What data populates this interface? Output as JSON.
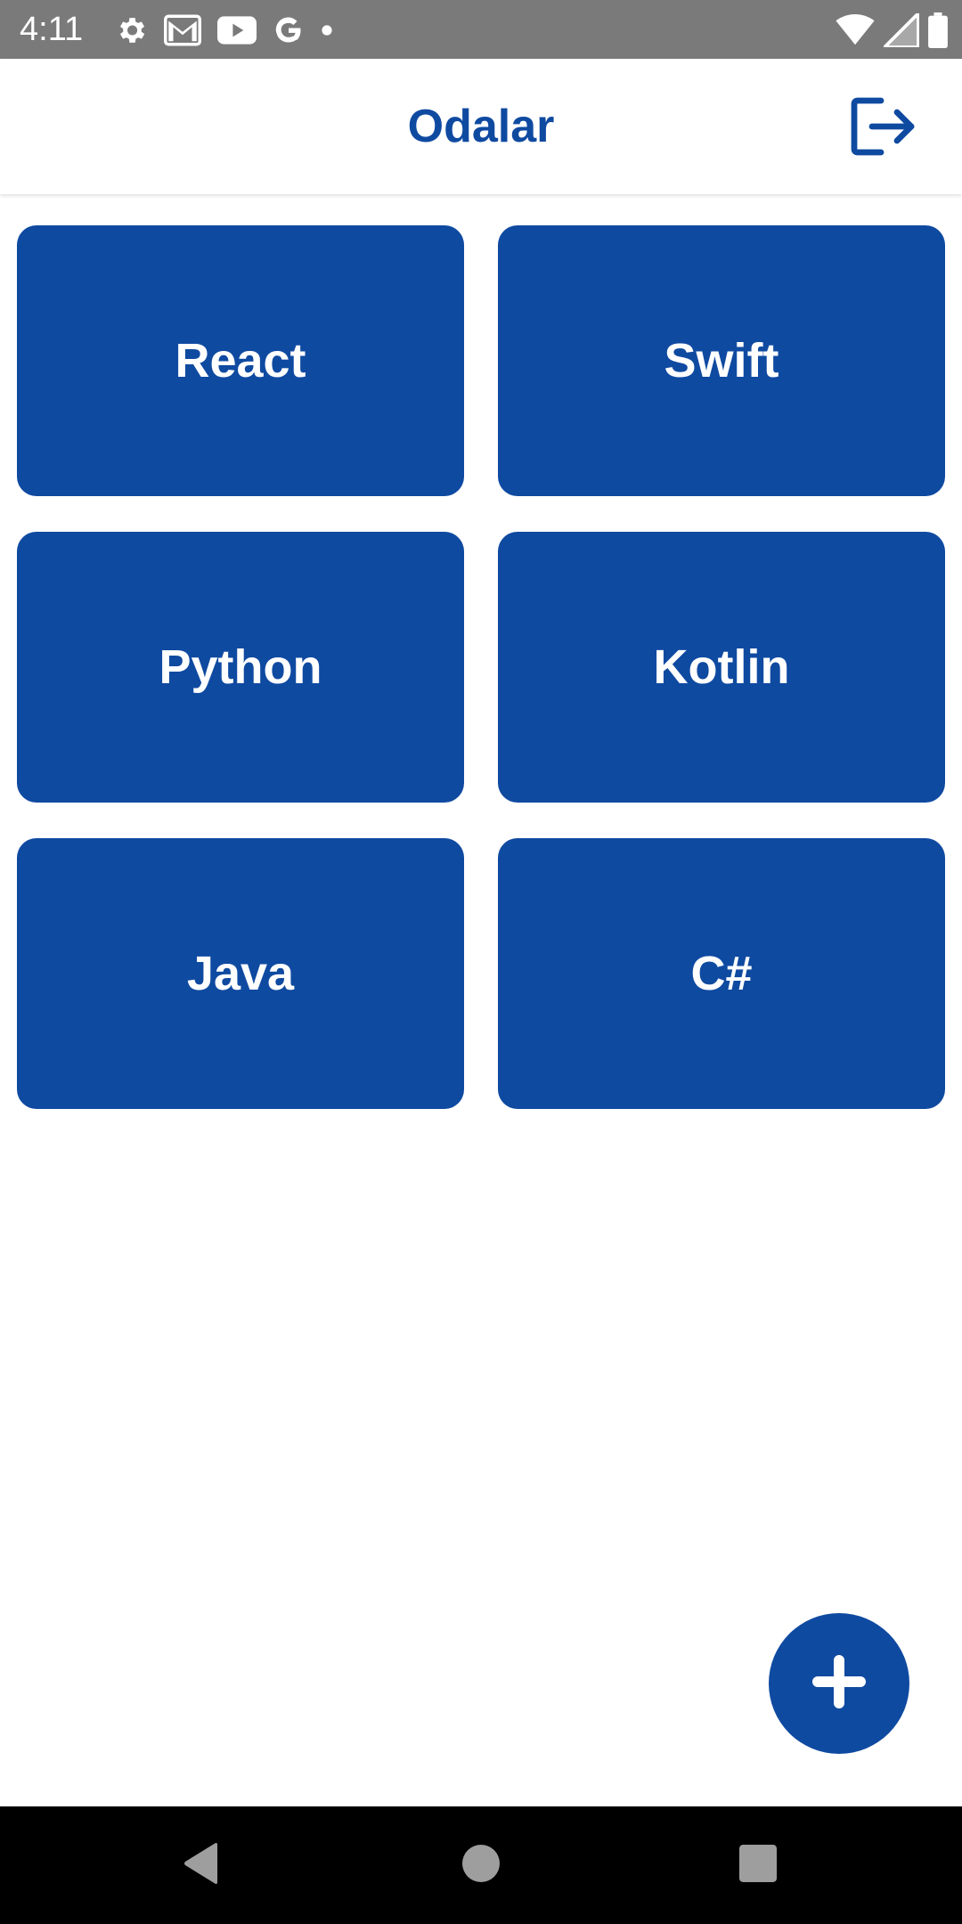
{
  "status_bar": {
    "time": "4:11",
    "left_icons": [
      "gear-icon",
      "gmail-icon",
      "youtube-icon",
      "google-icon",
      "dot-icon"
    ],
    "right_icons": [
      "wifi-icon",
      "signal-icon",
      "battery-icon"
    ]
  },
  "app_bar": {
    "title": "Odalar",
    "action_icon": "logout-icon"
  },
  "rooms": [
    {
      "label": "React"
    },
    {
      "label": "Swift"
    },
    {
      "label": "Python"
    },
    {
      "label": "Kotlin"
    },
    {
      "label": "Java"
    },
    {
      "label": "C#"
    }
  ],
  "fab": {
    "icon": "plus-icon"
  },
  "nav_bar": {
    "icons": [
      "back-icon",
      "home-icon",
      "recents-icon"
    ]
  },
  "colors": {
    "primary": "#0f4aa1",
    "status_bar": "#7a7a7a",
    "nav_bar": "#000000",
    "background": "#ffffff"
  }
}
